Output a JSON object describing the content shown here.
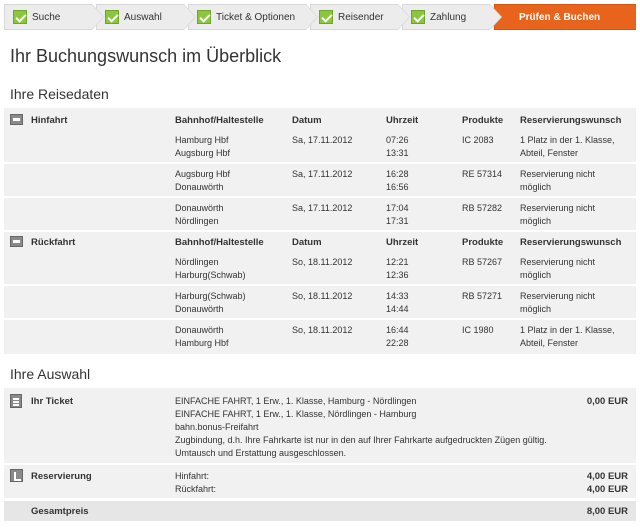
{
  "steps": [
    {
      "label": "Suche",
      "done": true
    },
    {
      "label": "Auswahl",
      "done": true
    },
    {
      "label": "Ticket & Optionen",
      "done": true
    },
    {
      "label": "Reisender",
      "done": true
    },
    {
      "label": "Zahlung",
      "done": true
    },
    {
      "label": "Prüfen & Buchen",
      "done": false,
      "active": true
    }
  ],
  "page_title": "Ihr Buchungswunsch im Überblick",
  "reisedaten": {
    "heading": "Ihre Reisedaten",
    "columns": {
      "station": "Bahnhof/Haltestelle",
      "date": "Datum",
      "time": "Uhrzeit",
      "products": "Produkte",
      "reservation": "Reservierungswunsch"
    },
    "hinfahrt": {
      "label": "Hinfahrt",
      "legs": [
        {
          "from": "Hamburg Hbf",
          "to": "Augsburg Hbf",
          "date": "Sa, 17.11.2012",
          "dep": "07:26",
          "arr": "13:31",
          "product": "IC 2083",
          "res1": "1 Platz in der 1. Klasse,",
          "res2": "Abteil, Fenster"
        },
        {
          "from": "Augsburg Hbf",
          "to": "Donauwörth",
          "date": "Sa, 17.11.2012",
          "dep": "16:28",
          "arr": "16:56",
          "product": "RE 57314",
          "res1": "Reservierung nicht",
          "res2": "möglich"
        },
        {
          "from": "Donauwörth",
          "to": "Nördlingen",
          "date": "Sa, 17.11.2012",
          "dep": "17:04",
          "arr": "17:31",
          "product": "RB 57282",
          "res1": "Reservierung nicht",
          "res2": "möglich"
        }
      ]
    },
    "rueckfahrt": {
      "label": "Rückfahrt",
      "legs": [
        {
          "from": "Nördlingen",
          "to": "Harburg(Schwab)",
          "date": "So, 18.11.2012",
          "dep": "12:21",
          "arr": "12:36",
          "product": "RB 57267",
          "res1": "Reservierung nicht",
          "res2": "möglich"
        },
        {
          "from": "Harburg(Schwab)",
          "to": "Donauwörth",
          "date": "So, 18.11.2012",
          "dep": "14:33",
          "arr": "14:44",
          "product": "RB 57271",
          "res1": "Reservierung nicht",
          "res2": "möglich"
        },
        {
          "from": "Donauwörth",
          "to": "Hamburg Hbf",
          "date": "So, 18.11.2012",
          "dep": "16:44",
          "arr": "22:28",
          "product": "IC 1980",
          "res1": "1 Platz in der 1. Klasse,",
          "res2": "Abteil, Fenster"
        }
      ]
    }
  },
  "auswahl": {
    "heading": "Ihre Auswahl",
    "ticket": {
      "label": "Ihr Ticket",
      "lines": [
        "EINFACHE FAHRT, 1 Erw., 1. Klasse, Hamburg - Nördlingen",
        "EINFACHE FAHRT, 1 Erw., 1. Klasse, Nördlingen - Hamburg",
        "bahn.bonus-Freifahrt",
        "Zugbindung, d.h. Ihre Fahrkarte ist nur in den auf Ihrer Fahrkarte aufgedruckten Zügen gültig.",
        "Umtausch und Erstattung ausgeschlossen."
      ],
      "price": "0,00 EUR"
    },
    "reservierung": {
      "label": "Reservierung",
      "hin_label": "Hinfahrt:",
      "rueck_label": "Rückfahrt:",
      "hin_price": "4,00 EUR",
      "rueck_price": "4,00 EUR"
    },
    "gesamt": {
      "label": "Gesamtpreis",
      "price": "8,00 EUR"
    }
  }
}
